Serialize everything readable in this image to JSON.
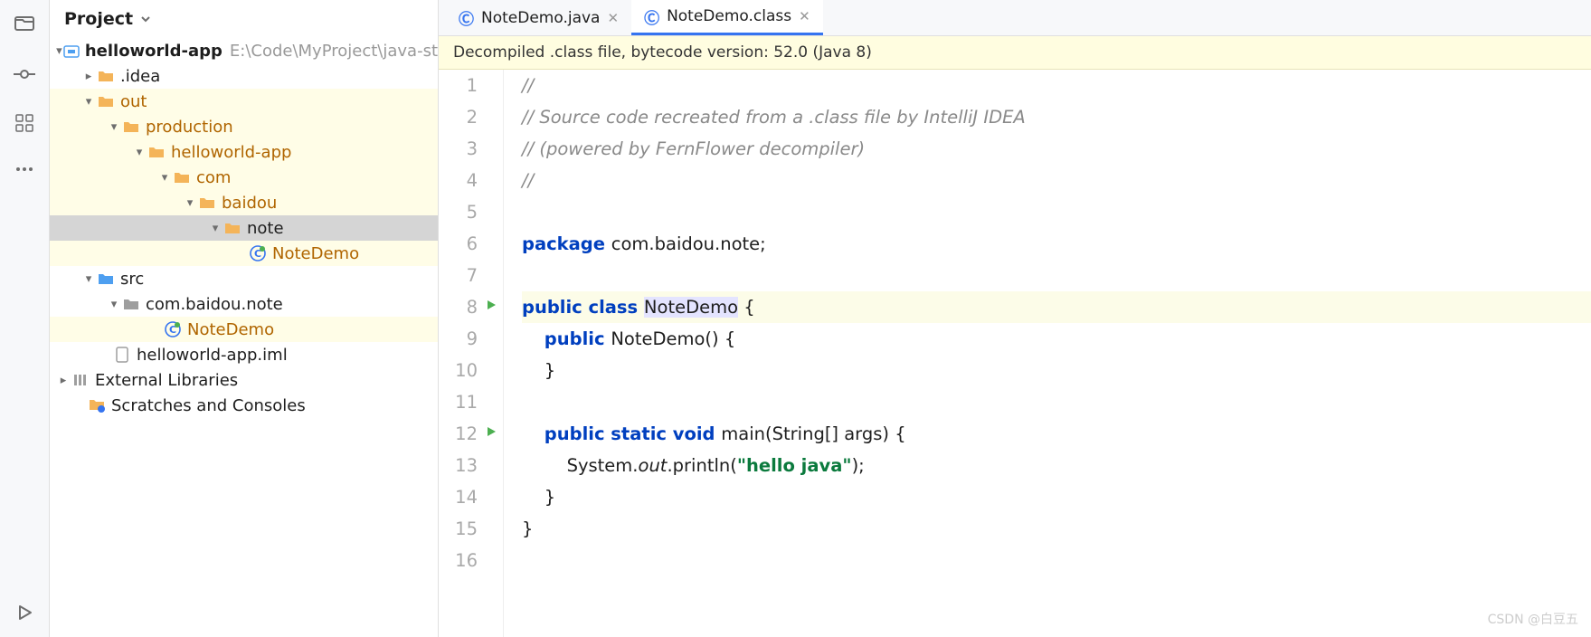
{
  "panel": {
    "title": "Project"
  },
  "tree": {
    "root": {
      "name": "helloworld-app",
      "path": "E:\\Code\\MyProject\\java-st"
    },
    "idea": ".idea",
    "out": "out",
    "production": "production",
    "hwapp": "helloworld-app",
    "com": "com",
    "baidou": "baidou",
    "note": "note",
    "notedemo1": "NoteDemo",
    "src": "src",
    "pkgpath": "com.baidou.note",
    "notedemo2": "NoteDemo",
    "iml": "helloworld-app.iml",
    "extlib": "External Libraries",
    "scratches": "Scratches and Consoles"
  },
  "tabs": [
    {
      "label": "NoteDemo.java",
      "active": false
    },
    {
      "label": "NoteDemo.class",
      "active": true
    }
  ],
  "banner": "Decompiled .class file, bytecode version: 52.0 (Java 8)",
  "code": {
    "lines": [
      {
        "n": 1,
        "segs": [
          {
            "t": "//",
            "c": "cmt"
          }
        ]
      },
      {
        "n": 2,
        "segs": [
          {
            "t": "// Source code recreated from a .class file by IntelliJ IDEA",
            "c": "cmt"
          }
        ]
      },
      {
        "n": 3,
        "segs": [
          {
            "t": "// (powered by FernFlower decompiler)",
            "c": "cmt"
          }
        ]
      },
      {
        "n": 4,
        "segs": [
          {
            "t": "//",
            "c": "cmt"
          }
        ]
      },
      {
        "n": 5,
        "segs": []
      },
      {
        "n": 6,
        "segs": [
          {
            "t": "package ",
            "c": "kw"
          },
          {
            "t": "com.baidou.note;"
          }
        ]
      },
      {
        "n": 7,
        "segs": []
      },
      {
        "n": 8,
        "run": true,
        "cur": true,
        "segs": [
          {
            "t": "public class ",
            "c": "kw"
          },
          {
            "t": "NoteDemo",
            "c": "tok-hl"
          },
          {
            "t": " {"
          }
        ]
      },
      {
        "n": 9,
        "segs": [
          {
            "t": "    "
          },
          {
            "t": "public ",
            "c": "kw"
          },
          {
            "t": "NoteDemo() {"
          }
        ]
      },
      {
        "n": 10,
        "segs": [
          {
            "t": "    }"
          }
        ]
      },
      {
        "n": 11,
        "segs": []
      },
      {
        "n": 12,
        "run": true,
        "segs": [
          {
            "t": "    "
          },
          {
            "t": "public static void ",
            "c": "kw"
          },
          {
            "t": "main(String[] args) {"
          }
        ]
      },
      {
        "n": 13,
        "segs": [
          {
            "t": "        System."
          },
          {
            "t": "out",
            "c": "static-it"
          },
          {
            "t": ".println("
          },
          {
            "t": "\"hello java\"",
            "c": "str"
          },
          {
            "t": ");"
          }
        ]
      },
      {
        "n": 14,
        "segs": [
          {
            "t": "    }"
          }
        ]
      },
      {
        "n": 15,
        "segs": [
          {
            "t": "}"
          }
        ]
      },
      {
        "n": 16,
        "segs": []
      }
    ]
  },
  "watermark": "CSDN @白豆五"
}
